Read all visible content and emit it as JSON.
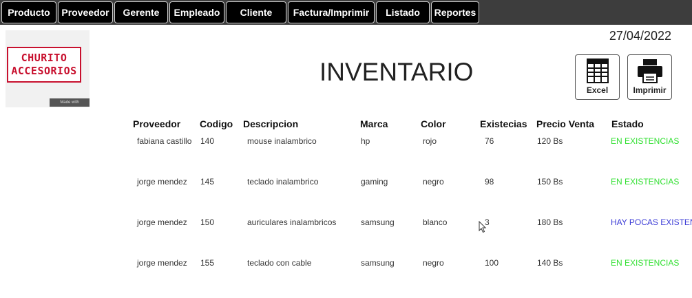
{
  "nav": {
    "items": [
      {
        "label": "Producto",
        "key": "producto"
      },
      {
        "label": "Proveedor",
        "key": "proveedor"
      },
      {
        "label": "Gerente",
        "key": "gerente"
      },
      {
        "label": "Empleado",
        "key": "empleado"
      },
      {
        "label": "Cliente",
        "key": "cliente"
      },
      {
        "label": "Factura/Imprimir",
        "key": "factura"
      },
      {
        "label": "Listado",
        "key": "listado"
      },
      {
        "label": "Reportes",
        "key": "reportes"
      }
    ]
  },
  "header": {
    "date": "27/04/2022",
    "title": "INVENTARIO",
    "logo": {
      "line1": "CHURITO",
      "line2": "ACCESORIOS",
      "badge": "Made with"
    }
  },
  "actions": {
    "excel_label": "Excel",
    "print_label": "Imprimir"
  },
  "table": {
    "headers": [
      "Proveedor",
      "Codigo",
      "Descripcion",
      "Marca",
      "Color",
      "Existecias",
      "Precio Venta",
      "Estado"
    ],
    "rows": [
      {
        "proveedor": "fabiana castillo",
        "codigo": "140",
        "descripcion": "mouse inalambrico",
        "marca": "hp",
        "color": "rojo",
        "existencias": "76",
        "precio": "120 Bs",
        "estado": "EN EXISTENCIAS",
        "estado_color": "#33e033"
      },
      {
        "proveedor": "jorge mendez",
        "codigo": "145",
        "descripcion": "teclado inalambrico",
        "marca": "gaming",
        "color": "negro",
        "existencias": "98",
        "precio": "150 Bs",
        "estado": "EN EXISTENCIAS",
        "estado_color": "#33e033"
      },
      {
        "proveedor": "jorge mendez",
        "codigo": "150",
        "descripcion": "auriculares inalambricos",
        "marca": "samsung",
        "color": "blanco",
        "existencias": "3",
        "precio": "180 Bs",
        "estado": "HAY POCAS EXISTENCIAS",
        "estado_color": "#3b3bd6"
      },
      {
        "proveedor": "jorge mendez",
        "codigo": "155",
        "descripcion": "teclado con cable",
        "marca": "samsung",
        "color": "negro",
        "existencias": "100",
        "precio": "140 Bs",
        "estado": "EN EXISTENCIAS",
        "estado_color": "#33e033"
      }
    ]
  },
  "colors": {
    "topbar": "#3d3d3d",
    "nav_button": "#000000",
    "brand_red": "#c8102e",
    "ok_green": "#33e033",
    "low_blue": "#3b3bd6"
  }
}
